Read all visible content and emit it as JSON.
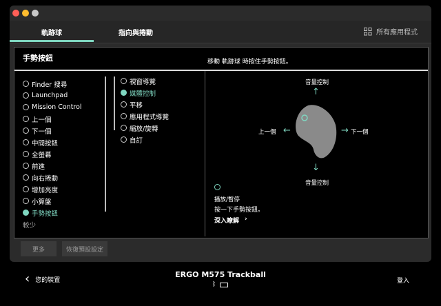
{
  "tabs": [
    {
      "label": "軌跡球",
      "active": true
    },
    {
      "label": "指向與捲動",
      "active": false
    }
  ],
  "all_apps": {
    "label": "所有應用程式",
    "icon": "grid-icon"
  },
  "panel": {
    "title": "手勢按鈕",
    "description": "移動 軌跡球 時按住手勢按鈕。"
  },
  "left_list": {
    "items": [
      {
        "label": "Finder 搜尋",
        "selected": false
      },
      {
        "label": "Launchpad",
        "selected": false
      },
      {
        "label": "Mission Control",
        "selected": false
      },
      {
        "label": "上一個",
        "selected": false
      },
      {
        "label": "下一個",
        "selected": false
      },
      {
        "label": "中間按鈕",
        "selected": false
      },
      {
        "label": "全螢幕",
        "selected": false
      },
      {
        "label": "前進",
        "selected": false
      },
      {
        "label": "向右捲動",
        "selected": false
      },
      {
        "label": "增加亮度",
        "selected": false
      },
      {
        "label": "小算盤",
        "selected": false
      },
      {
        "label": "手勢按鈕",
        "selected": true
      }
    ],
    "less_label": "較少"
  },
  "middle_list": {
    "items": [
      {
        "label": "視窗導覽",
        "selected": false
      },
      {
        "label": "媒體控制",
        "selected": true
      },
      {
        "label": "平移",
        "selected": false
      },
      {
        "label": "應用程式導覽",
        "selected": false
      },
      {
        "label": "縮放/旋轉",
        "selected": false
      },
      {
        "label": "自訂",
        "selected": false
      }
    ]
  },
  "diagram": {
    "up": "音量控制",
    "down": "音量控制",
    "left": "上一個",
    "right": "下一個",
    "click_title": "播放/暫停",
    "click_desc": "按一下手勢按鈕。",
    "learn_more": "深入瞭解"
  },
  "buttons": {
    "more": "更多",
    "restore": "恢復預設設定"
  },
  "footer": {
    "back_label": "您的裝置",
    "device_name": "ERGO M575 Trackball",
    "login_label": "登入"
  },
  "colors": {
    "accent": "#7fd6c0",
    "window_bg": "#2b2b2b",
    "panel_bg": "#000000"
  }
}
